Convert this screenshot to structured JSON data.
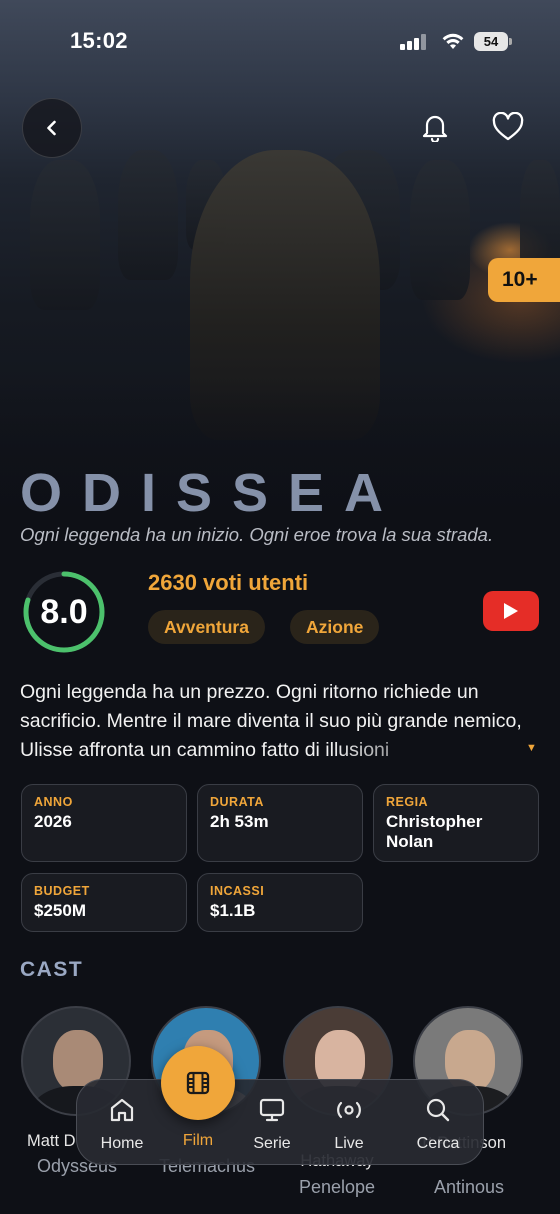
{
  "status_bar": {
    "time": "15:02",
    "battery": "54"
  },
  "hero": {
    "age_rating": "10+"
  },
  "movie": {
    "title": "ODISSEA",
    "tagline": "Ogni leggenda ha un inizio. Ogni eroe trova la sua strada.",
    "rating": "8.0",
    "rating_fraction": 0.8,
    "votes": "2630 voti utenti",
    "genres": [
      "Avventura",
      "Azione"
    ],
    "plot": "Ogni leggenda ha un prezzo. Ogni ritorno richiede un sacrificio. Mentre il mare diventa il suo più grande nemico, Ulisse affronta un cammino fatto di illusioni"
  },
  "details": [
    {
      "label": "ANNO",
      "value": "2026"
    },
    {
      "label": "DURATA",
      "value": "2h 53m"
    },
    {
      "label": "REGIA",
      "value": "Christopher Nolan"
    },
    {
      "label": "BUDGET",
      "value": "$250M"
    },
    {
      "label": "INCASSI",
      "value": "$1.1B"
    }
  ],
  "cast_heading": "CAST",
  "cast": [
    {
      "name": "Matt D",
      "role": "Odysseus"
    },
    {
      "name": "",
      "role": "Telemachus"
    },
    {
      "name": "Hathaway",
      "role": "Penelope"
    },
    {
      "name": "rt Pattinson",
      "role": "Antinous"
    }
  ],
  "nav": {
    "items": [
      {
        "label": "Home",
        "icon": "home-icon"
      },
      {
        "label": "Film",
        "icon": "film-icon",
        "active": true
      },
      {
        "label": "Serie",
        "icon": "tv-icon"
      },
      {
        "label": "Live",
        "icon": "live-icon"
      },
      {
        "label": "Cerca",
        "icon": "search-icon"
      }
    ]
  },
  "colors": {
    "accent": "#f0a63a",
    "rating_ring": "#4cc16c",
    "youtube": "#e52d27",
    "background": "#0e1016"
  }
}
